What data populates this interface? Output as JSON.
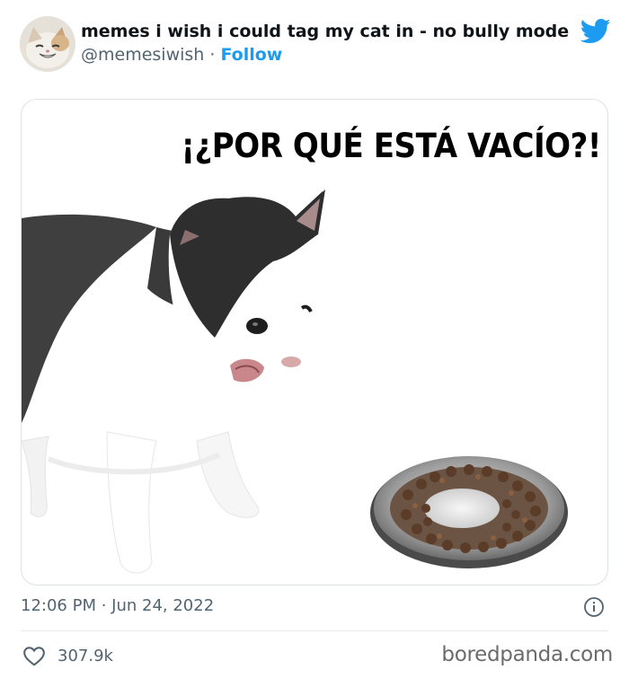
{
  "tweet": {
    "display_name": "memes i wish i could tag my cat in - no bully mode",
    "handle": "@memesiwish",
    "separator": " · ",
    "follow_label": "Follow",
    "timestamp": "12:06 PM · Jun 24, 2022",
    "like_count": "307.9k"
  },
  "media": {
    "caption": "¡¿POR QUÉ ESTÁ VACÍO?!"
  },
  "watermark": "boredpanda.com",
  "colors": {
    "accent": "#1d9bf0",
    "muted_text": "#536471",
    "text": "#0f1419"
  },
  "icons": {
    "platform": "twitter-bird-icon",
    "info": "info-icon",
    "like": "heart-icon"
  }
}
